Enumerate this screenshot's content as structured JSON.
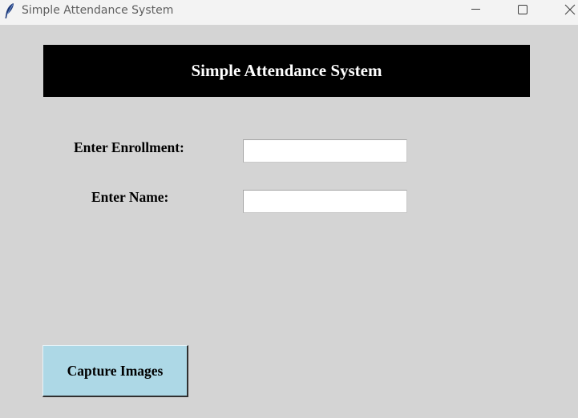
{
  "window": {
    "title": "Simple Attendance System",
    "icon": "feather-icon",
    "controls": [
      "minimize-icon",
      "maximize-icon",
      "close-icon"
    ]
  },
  "header": {
    "title": "Simple Attendance System"
  },
  "form": {
    "enrollment_label": "Enter Enrollment:",
    "enrollment_value": "",
    "name_label": "Enter Name:",
    "name_value": ""
  },
  "actions": {
    "capture_label": "Capture Images"
  },
  "colors": {
    "background": "#d4d4d4",
    "titlebar": "#f3f3f3",
    "banner": "#000000",
    "banner_text": "#ffffff",
    "button": "#add8e6"
  }
}
